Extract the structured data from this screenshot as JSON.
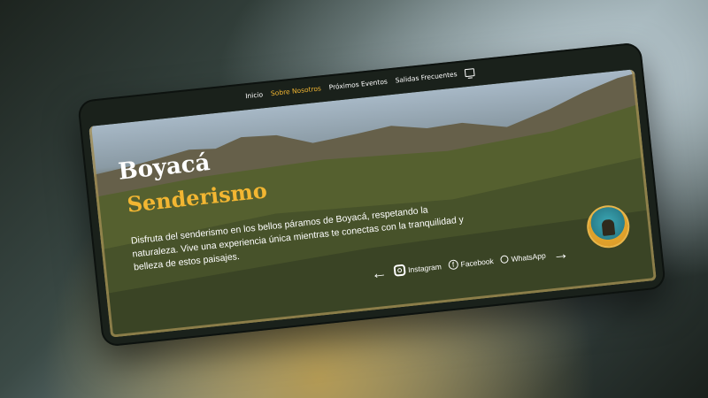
{
  "nav": {
    "items": [
      {
        "label": "Inicio"
      },
      {
        "label": "Sobre Nosotros"
      },
      {
        "label": "Próximos Eventos"
      },
      {
        "label": "Salidas Frecuentes"
      }
    ],
    "active_color": "#f2b632"
  },
  "hero": {
    "title": "Boyacá",
    "subtitle": "Senderismo",
    "description": "Disfruta del senderismo en los bellos páramos de Boyacá, respetando la naturaleza. Vive una experiencia única mientras te conectas con la tranquilidad y belleza de estos paisajes.",
    "accent_color": "#f2b632"
  },
  "social": {
    "instagram": "Instagram",
    "facebook": "Facebook",
    "whatsapp": "WhatsApp",
    "prev_icon": "arrow-left-icon",
    "next_icon": "arrow-right-icon"
  }
}
